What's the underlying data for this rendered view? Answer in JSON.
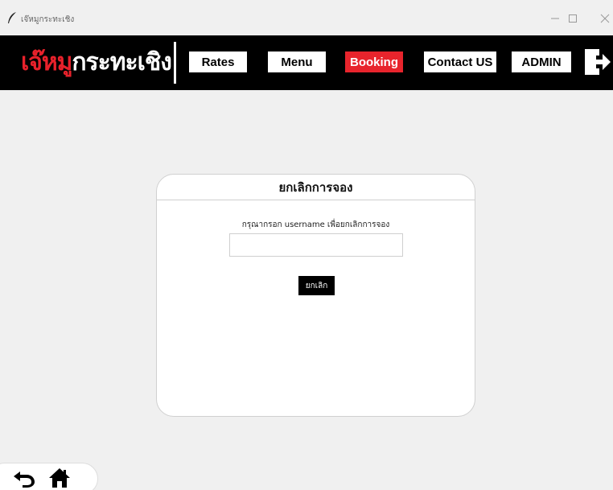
{
  "window": {
    "title": "เจ๊หมูกระทะเชิง",
    "app_icon": "feather-icon",
    "controls": [
      "minimize-icon",
      "maximize-icon",
      "close-icon"
    ]
  },
  "nav": {
    "logo_red": "เจ๊หมู",
    "logo_white": "กระทะเชิง",
    "rates_label": "Rates",
    "menu_label": "Menu",
    "booking_label": "Booking",
    "contact_label": "Contact US",
    "admin_label": "ADMIN",
    "exit_icon": "logout-icon",
    "active_color": "#e8242c",
    "brand_red": "#e8212b"
  },
  "card": {
    "title": "ยกเลิกการจอง",
    "label": "กรุณากรอก username เพื่อยกเลิกการจอง",
    "input_value": "",
    "input_placeholder": "",
    "cancel_label": "ยกเลิก"
  },
  "bottom": {
    "back_icon": "back-arrow-icon",
    "home_icon": "home-icon"
  }
}
